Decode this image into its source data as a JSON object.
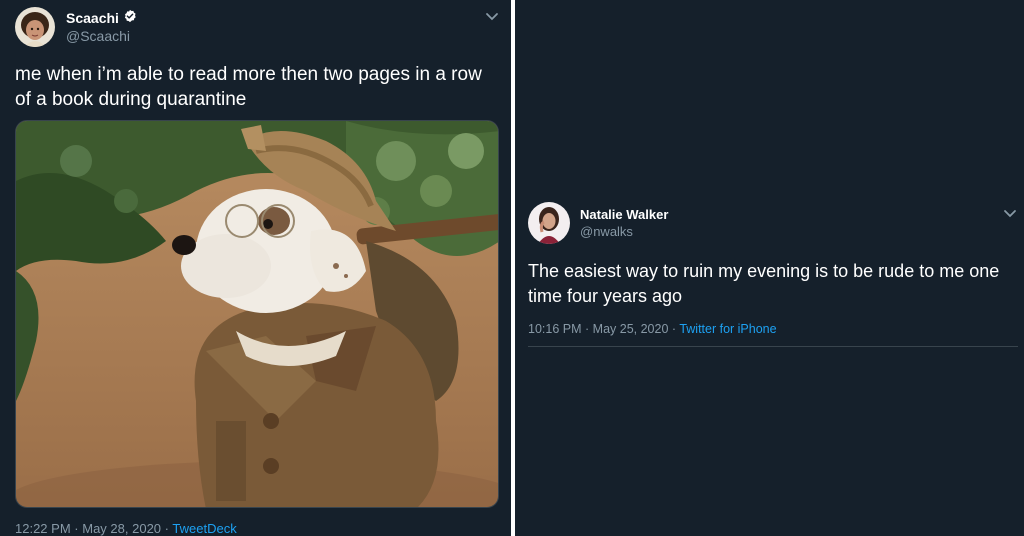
{
  "tweets": [
    {
      "display_name": "Scaachi",
      "handle": "@Scaachi",
      "verified": true,
      "text": "me when i’m able to read more then two pages in a row of a book during quarantine",
      "media_description_icon": "dog-in-costume-photo",
      "time": "12:22 PM",
      "date": "May 28, 2020",
      "separator": "·",
      "source": "TweetDeck"
    },
    {
      "display_name": "Natalie Walker",
      "handle": "@nwalks",
      "verified": false,
      "text": "The easiest way to ruin my evening is to be rude to me one time four years ago",
      "time": "10:16 PM",
      "date": "May 25, 2020",
      "separator": "·",
      "source": "Twitter for iPhone"
    }
  ],
  "colors": {
    "background": "#15202b",
    "text": "#ffffff",
    "muted": "#8899a6",
    "link": "#1da1f2",
    "border": "#38444d"
  }
}
